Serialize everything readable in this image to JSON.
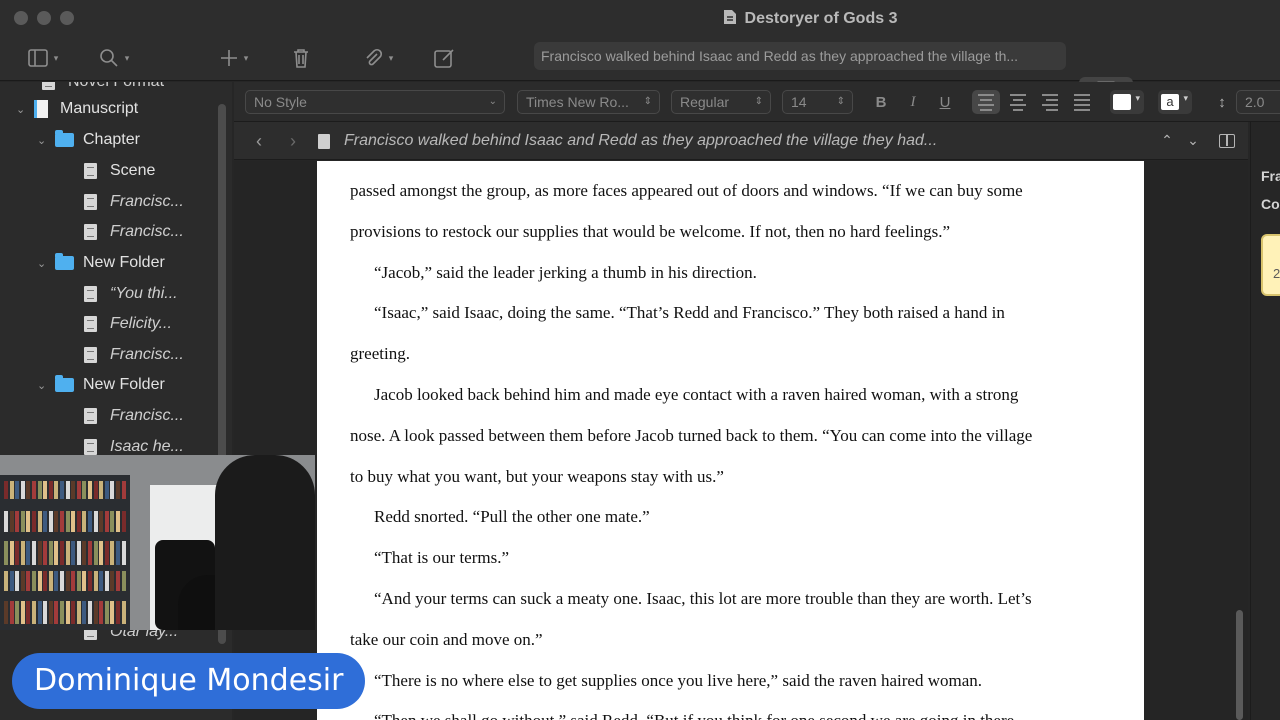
{
  "window": {
    "title": "Destoryer of Gods 3"
  },
  "toolbar": {
    "search_text": "Francisco walked behind Isaac and Redd as they approached the village th..."
  },
  "binder": {
    "partial_top": "Novel Format",
    "items": [
      {
        "label": "Manuscript",
        "kind": "manuscript",
        "level": 0
      },
      {
        "label": "Chapter",
        "kind": "folder",
        "level": 1
      },
      {
        "label": "Scene",
        "kind": "doc",
        "level": 2
      },
      {
        "label": "Francisc...",
        "kind": "doc",
        "level": 2,
        "italic": true
      },
      {
        "label": "Francisc...",
        "kind": "doc",
        "level": 2,
        "italic": true
      },
      {
        "label": "New Folder",
        "kind": "folder",
        "level": 1
      },
      {
        "label": "“You thi...",
        "kind": "doc",
        "level": 2,
        "italic": true
      },
      {
        "label": "Felicity...",
        "kind": "doc",
        "level": 2,
        "italic": true
      },
      {
        "label": "Francisc...",
        "kind": "doc",
        "level": 2,
        "italic": true
      },
      {
        "label": "New Folder",
        "kind": "folder",
        "level": 1
      },
      {
        "label": "Francisc...",
        "kind": "doc",
        "level": 2,
        "italic": true
      },
      {
        "label": "Isaac he...",
        "kind": "doc",
        "level": 2,
        "italic": true
      }
    ],
    "partial_bottom": "Otar lay..."
  },
  "format": {
    "style": "No Style",
    "font": "Times New Ro...",
    "weight": "Regular",
    "size": "14",
    "bold": "B",
    "italic": "I",
    "underline": "U",
    "highlight_letter": "a",
    "line_spacing": "2.0"
  },
  "header": {
    "title": "Francisco walked behind Isaac and Redd as they approached the village they had..."
  },
  "document": {
    "lines": [
      "passed amongst the group, as more faces appeared out of doors and windows. “If we can buy some",
      "provisions to restock our supplies that would be welcome. If not, then no hard feelings.”",
      "“Jacob,” said the leader jerking a thumb in his direction.",
      "“Isaac,” said Isaac, doing the same. “That’s Redd and Francisco.” They both raised a hand in",
      "greeting.",
      "Jacob looked back behind him and made eye contact with a raven haired woman, with a strong",
      "nose. A look passed between them before Jacob turned back to them. “You can come into the village",
      "to buy what you want, but your weapons stay with us.”",
      "Redd snorted. “Pull the other one mate.”",
      "“That is our terms.”",
      "“And your terms can suck a meaty one. Isaac, this lot are more trouble than they are worth. Let’s",
      "take our coin and move on.”",
      "“There is no where else to get supplies once you live here,” said the raven haired woman.",
      "“Then we shall go without,” said Redd. “But if you think for one second we are going in there"
    ],
    "indents": [
      false,
      false,
      true,
      true,
      false,
      true,
      false,
      false,
      true,
      true,
      true,
      false,
      true,
      true
    ]
  },
  "inspector": {
    "line1": "Fra",
    "line2": "Co",
    "note": "2"
  },
  "overlay": {
    "presenter_name": "Dominique Mondesir"
  },
  "colors": {
    "accent": "#2f6ed8",
    "folder": "#4fb0ef",
    "note": "#fff2b8"
  }
}
